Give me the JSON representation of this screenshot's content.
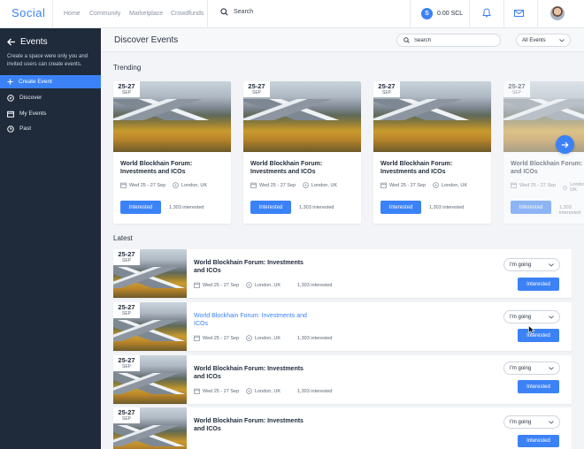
{
  "topbar": {
    "brand": "Social",
    "nav": [
      "Home",
      "Community",
      "Marketplace",
      "Crowdfunds"
    ],
    "search_label": "Search",
    "wallet_symbol": "S",
    "wallet_amount": "0.00 SCL",
    "icons": [
      "search-icon",
      "bell-icon",
      "mail-icon",
      "avatar"
    ]
  },
  "sidebar": {
    "title": "Events",
    "description": "Create a space were only you and invited users can create events.",
    "items": [
      {
        "label": "Create Event",
        "icon": "plus-icon",
        "active": true
      },
      {
        "label": "Discover",
        "icon": "compass-icon",
        "active": false
      },
      {
        "label": "My Events",
        "icon": "calendar-icon",
        "active": false
      },
      {
        "label": "Past",
        "icon": "clock-icon",
        "active": false
      }
    ]
  },
  "main": {
    "title": "Discover Events",
    "search_placeholder": "Search",
    "filter_value": "All Events",
    "trending_title": "Trending",
    "latest_title": "Latest"
  },
  "trending": [
    {
      "date": "25-27",
      "month": "SEP",
      "title": "World Blockhain Forum: Investments and ICOs",
      "dates": "Wed 25 - 27 Sep",
      "location": "London, UK",
      "button": "Interested",
      "count": "1,303 interested"
    },
    {
      "date": "25-27",
      "month": "SEP",
      "title": "World Blockhain Forum: Investments and ICOs",
      "dates": "Wed 25 - 27 Sep",
      "location": "London, UK",
      "button": "Interested",
      "count": "1,303 interested"
    },
    {
      "date": "25-27",
      "month": "SEP",
      "title": "World Blockhain Forum: Investments and ICOs",
      "dates": "Wed 25 - 27 Sep",
      "location": "London, UK",
      "button": "Interested",
      "count": "1,303 interested"
    },
    {
      "date": "25-27",
      "month": "SEP",
      "title": "World Blockhain Forum: Investments and ICOs",
      "dates": "Wed 25 - 27 Sep",
      "location": "London, UK",
      "button": "Interested",
      "count": "1,303 interested"
    }
  ],
  "latest": [
    {
      "date": "25-27",
      "month": "SEP",
      "title": "World Blockhain Forum: Investments and ICOs",
      "dates": "Wed 25 - 27 Sep",
      "location": "London, UK",
      "count": "1,303 interested",
      "going": "I'm going",
      "button": "Interested",
      "hover": false
    },
    {
      "date": "25-27",
      "month": "SEP",
      "title": "World Blockhain Forum: Investments and ICOs",
      "dates": "Wed 25 - 27 Sep",
      "location": "London, UK",
      "count": "1,303 interested",
      "going": "I'm going",
      "button": "Interested",
      "hover": true
    },
    {
      "date": "25-27",
      "month": "SEP",
      "title": "World Blockhain Forum: Investments and ICOs",
      "dates": "Wed 25 - 27 Sep",
      "location": "London, UK",
      "count": "1,303 interested",
      "going": "I'm going",
      "button": "Interested",
      "hover": false
    },
    {
      "date": "25-27",
      "month": "SEP",
      "title": "World Blockhain Forum: Investments and ICOs",
      "dates": "Wed 25 - 27 Sep",
      "location": "London, UK",
      "count": "1,303 interested",
      "going": "I'm going",
      "button": "Interested",
      "hover": false
    }
  ],
  "colors": {
    "accent": "#3b82f6",
    "sidebar": "#1f2a3a"
  }
}
